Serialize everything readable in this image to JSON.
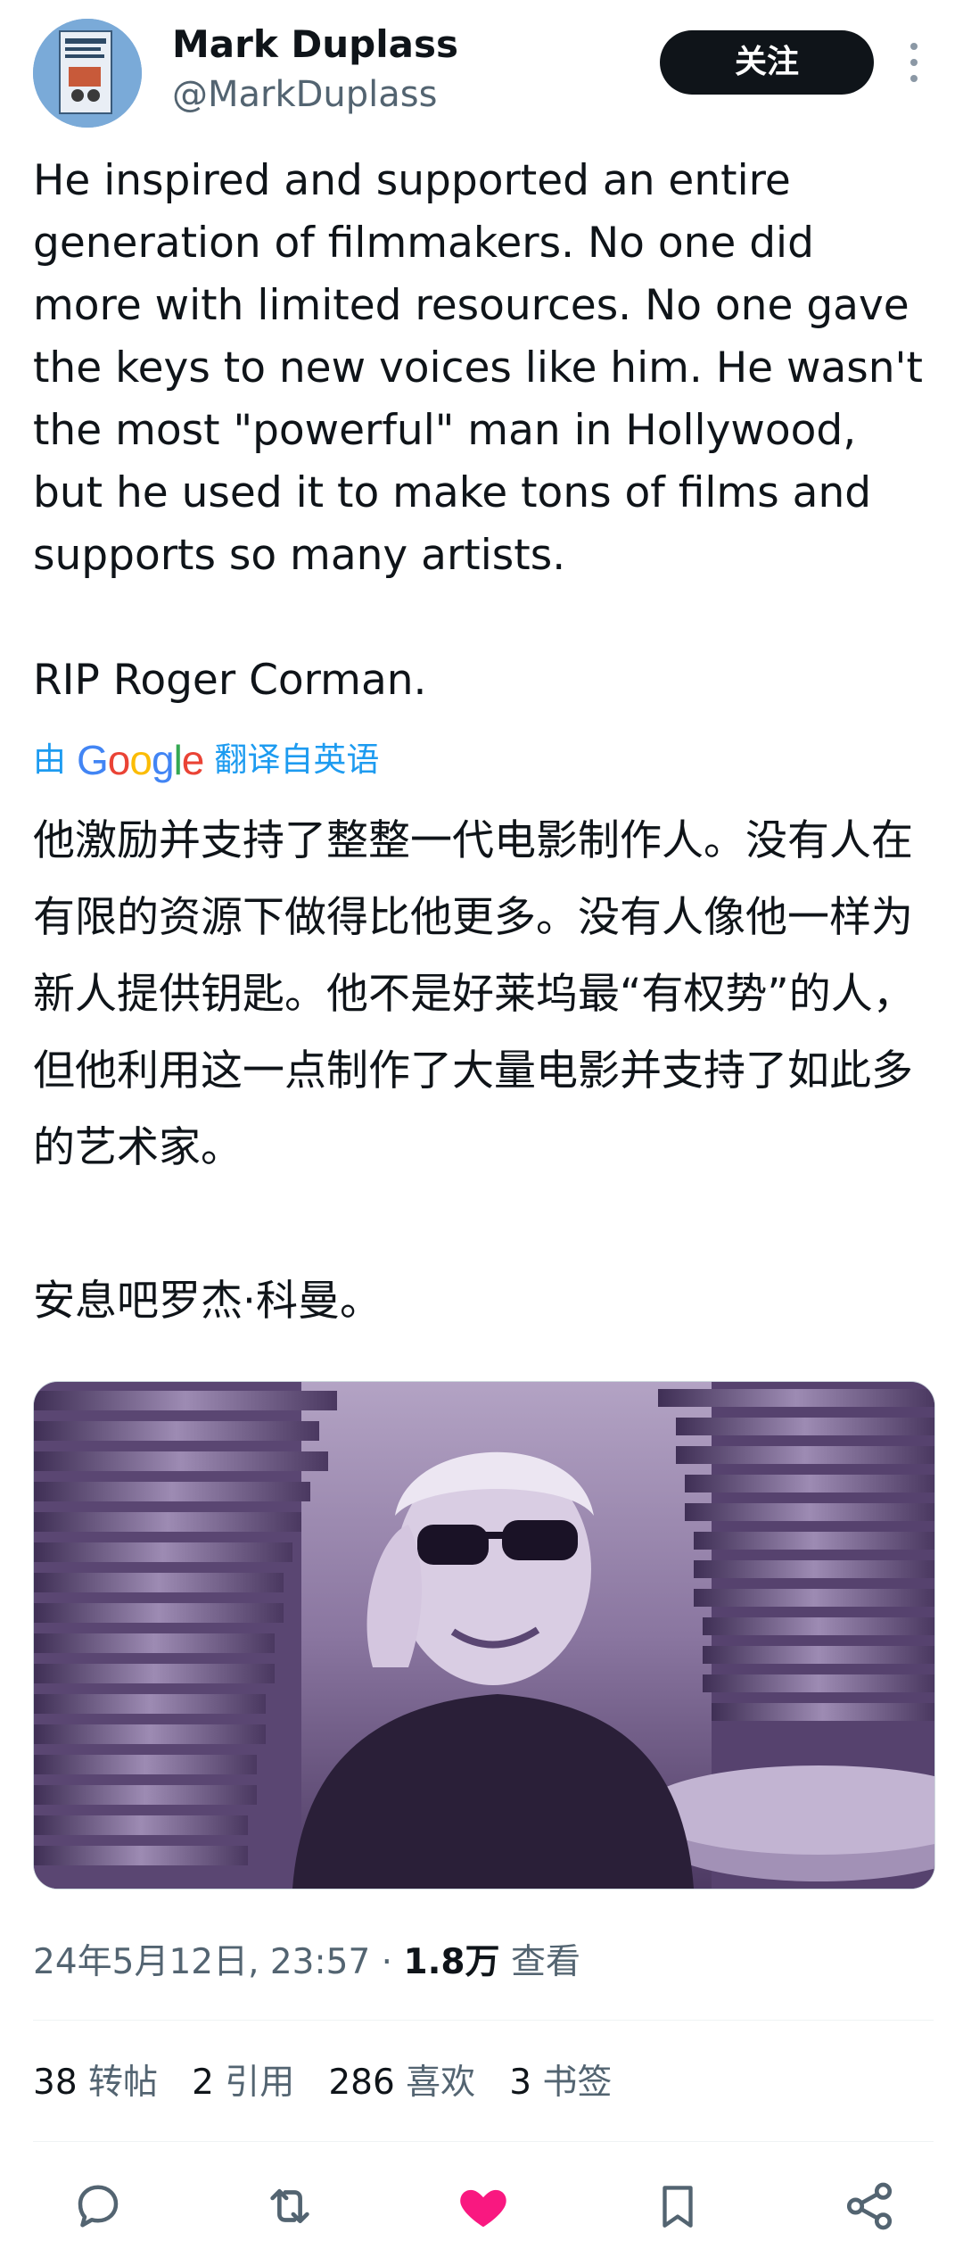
{
  "author": {
    "display_name": "Mark Duplass",
    "handle": "@MarkDuplass",
    "avatar_icon": "book-cover-avatar"
  },
  "header": {
    "follow_label": "关注",
    "more_icon": "more-vertical-icon"
  },
  "tweet": {
    "paragraph_1": "He inspired and supported an entire generation of filmmakers. No one did more with limited resources. No one gave the keys to new voices like him. He wasn't the most \"powerful\" man in Hollywood, but he used it to make tons of films and supports so many artists.",
    "paragraph_2": "RIP Roger Corman."
  },
  "translation": {
    "prefix": "由",
    "provider": "Google",
    "suffix": "翻译自英语",
    "paragraph_1": "他激励并支持了整整一代电影制作人。没有人在有限的资源下做得比他更多。没有人像他一样为新人提供钥匙。他不是好莱坞最“有权势”的人，但他利用这一点制作了大量电影并支持了如此多的艺术家。",
    "paragraph_2": "安息吧罗杰·科曼。"
  },
  "meta": {
    "timestamp": "24年5月12日, 23:57",
    "separator": " · ",
    "views_count": "1.8万",
    "views_label": " 查看"
  },
  "stats": {
    "reposts_count": "38",
    "reposts_label": "转帖",
    "quotes_count": "2",
    "quotes_label": "引用",
    "likes_count": "286",
    "likes_label": "喜欢",
    "bookmarks_count": "3",
    "bookmarks_label": "书签"
  },
  "colors": {
    "text": "#0f1419",
    "secondary": "#536471",
    "link": "#1d9bf0",
    "like_active": "#f91880",
    "media_tint": "#5a4570"
  },
  "actions": {
    "reply_icon": "reply-icon",
    "repost_icon": "repost-icon",
    "like_icon": "heart-filled-icon",
    "bookmark_icon": "bookmark-icon",
    "share_icon": "share-icon"
  }
}
